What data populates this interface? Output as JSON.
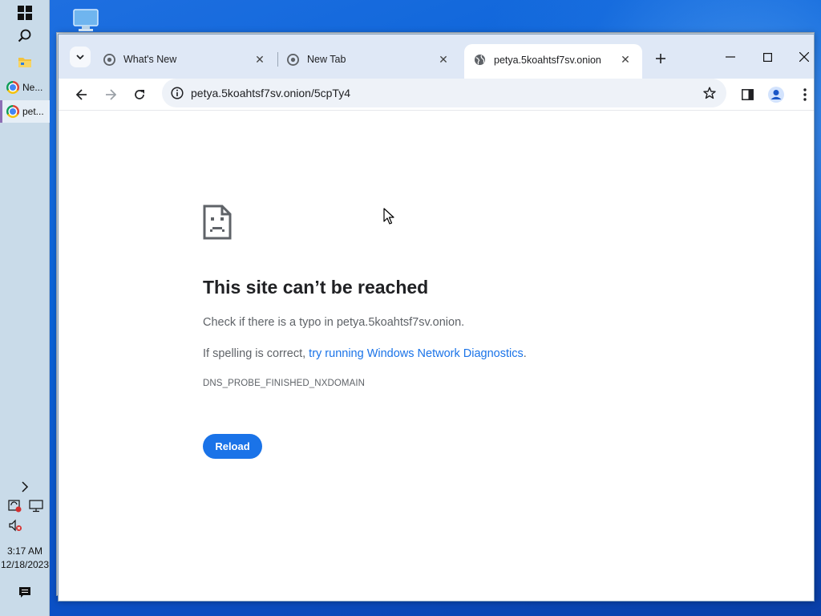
{
  "taskbar": {
    "apps": [
      {
        "label": "Ne..."
      },
      {
        "label": "pet..."
      }
    ],
    "clock": {
      "time": "3:17 AM",
      "date": "12/18/2023"
    }
  },
  "browser": {
    "tabs": [
      {
        "title": "What's New",
        "icon": "chrome-icon"
      },
      {
        "title": "New Tab",
        "icon": "chrome-icon"
      },
      {
        "title": "petya.5koahtsf7sv.onion",
        "icon": "globe-icon",
        "active": true
      }
    ],
    "address": {
      "url": "petya.5koahtsf7sv.onion/5cpTy4"
    },
    "accent_color": "#1a73e8"
  },
  "error_page": {
    "title": "This site can’t be reached",
    "line1": "Check if there is a typo in petya.5koahtsf7sv.onion.",
    "line2_prefix": "If spelling is correct, ",
    "line2_link": "try running Windows Network Diagnostics",
    "line2_suffix": ".",
    "error_code": "DNS_PROBE_FINISHED_NXDOMAIN",
    "reload_label": "Reload"
  }
}
